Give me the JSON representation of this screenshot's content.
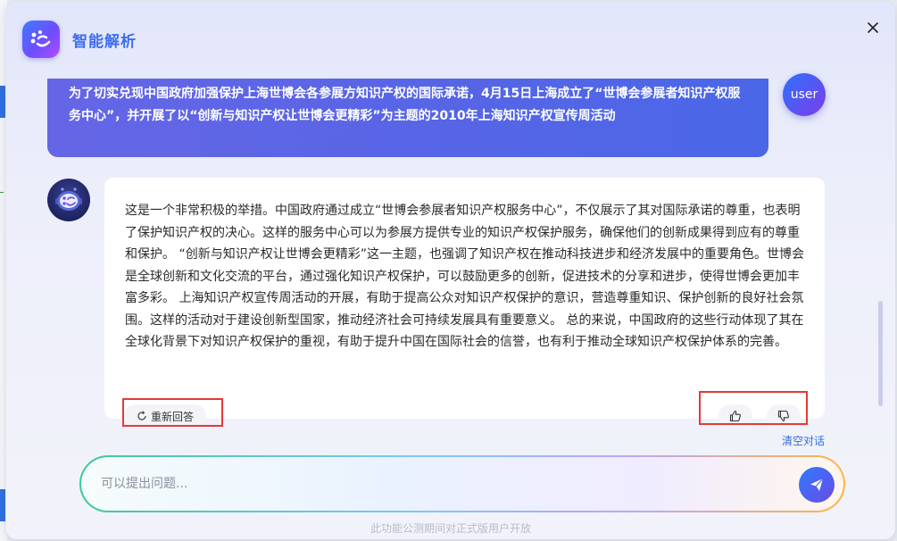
{
  "window": {
    "title": "智能解析",
    "close_symbol": "×"
  },
  "conversation": {
    "user": {
      "avatar_label": "user",
      "message": "为了切实兑现中国政府加强保护上海世博会各参展方知识产权的国际承诺，4月15日上海成立了“世博会参展者知识产权服务中心”，并开展了以“创新与知识产权让世博会更精彩”为主题的2010年上海知识产权宣传周活动"
    },
    "bot": {
      "message": "这是一个非常积极的举措。中国政府通过成立“世博会参展者知识产权服务中心”，不仅展示了其对国际承诺的尊重，也表明了保护知识产权的决心。这样的服务中心可以为参展方提供专业的知识产权保护服务，确保他们的创新成果得到应有的尊重和保护。 “创新与知识产权让世博会更精彩”这一主题，也强调了知识产权在推动科技进步和经济发展中的重要角色。世博会是全球创新和文化交流的平台，通过强化知识产权保护，可以鼓励更多的创新，促进技术的分享和进步，使得世博会更加丰富多彩。 上海知识产权宣传周活动的开展，有助于提高公众对知识产权保护的意识，营造尊重知识、保护创新的良好社会氛围。这样的活动对于建设创新型国家，推动经济社会可持续发展具有重要意义。 总的来说，中国政府的这些行动体现了其在全球化背景下对知识产权保护的重视，有助于提升中国在国际社会的信誉，也有利于推动全球知识产权保护体系的完善。",
      "regenerate_label": "重新回答"
    }
  },
  "actions": {
    "clear_label": "清空对话"
  },
  "input": {
    "placeholder": "可以提出问题...",
    "value": ""
  },
  "footer": {
    "note": "此功能公测期间对正式版用户开放"
  },
  "colors": {
    "accent": "#3e6df2",
    "user_bubble": "#5565e6",
    "highlight_box": "#e53935"
  }
}
